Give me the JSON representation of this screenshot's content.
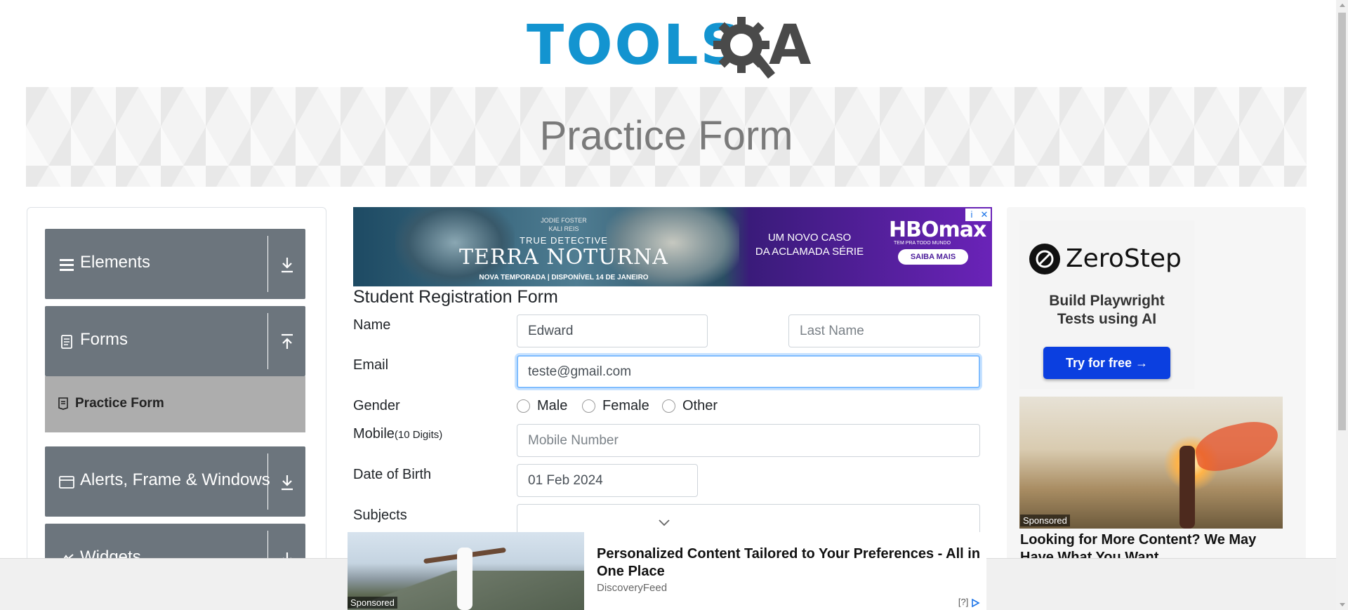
{
  "header": {
    "logo_main": "TOOLS",
    "logo_tail": "A"
  },
  "banner": {
    "title": "Practice Form"
  },
  "sidebar": {
    "groups": [
      {
        "label": "Elements",
        "icon": "hamburger-icon",
        "arrow": "download-arrow-icon"
      },
      {
        "label": "Forms",
        "icon": "document-icon",
        "arrow": "upload-arrow-icon"
      },
      {
        "label": "Alerts, Frame & Windows",
        "icon": "window-icon",
        "arrow": "download-arrow-icon"
      },
      {
        "label": "Widgets",
        "icon": "widget-icon",
        "arrow": "download-arrow-icon"
      }
    ],
    "active_item": {
      "label": "Practice Form",
      "icon": "form-icon"
    }
  },
  "top_ad": {
    "names": "JODIE FOSTER\nKALI REIS",
    "series_label": "TRUE DETECTIVE",
    "series_title": "TERRA NOTURNA",
    "footer": "NOVA TEMPORADA | DISPONÍVEL 14 DE JANEIRO",
    "tagline": "UM NOVO CASO\nDA ACLAMADA SÉRIE",
    "brand": "HBOmax",
    "brand_sub": "TEM PRA TODO MUNDO",
    "cta": "SAIBA MAIS",
    "controls": {
      "info": "i",
      "close": "✕"
    }
  },
  "form": {
    "title": "Student Registration Form",
    "name_label": "Name",
    "first_name_value": "Edward",
    "last_name_placeholder": "Last Name",
    "email_label": "Email",
    "email_value": "teste@gmail.com",
    "gender_label": "Gender",
    "gender_options": [
      "Male",
      "Female",
      "Other"
    ],
    "mobile_label": "Mobile",
    "mobile_hint": "(10 Digits)",
    "mobile_placeholder": "Mobile Number",
    "dob_label": "Date of Birth",
    "dob_value": "01 Feb 2024",
    "subjects_label": "Subjects"
  },
  "right_ad": {
    "brand": "ZeroStep",
    "line1": "Build Playwright",
    "line2": "Tests using AI",
    "cta": "Try for free →",
    "sponsored": "Sponsored",
    "headline": "Looking for More Content? We May Have What You Want"
  },
  "bottom_ad": {
    "sponsored": "Sponsored",
    "headline": "Personalized Content Tailored to Your Preferences - All in One Place",
    "source": "DiscoveryFeed",
    "info": "[?]"
  },
  "colors": {
    "brand_blue": "#1394d0",
    "menu_gray": "#6c757d",
    "active_gray": "#adadad",
    "focus_blue": "#80bdff",
    "cta_blue": "#0b3fe0"
  }
}
